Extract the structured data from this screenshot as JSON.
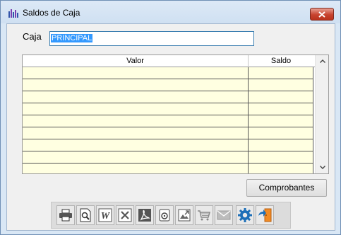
{
  "window": {
    "title": "Saldos de Caja"
  },
  "form": {
    "caja_label": "Caja",
    "caja_value": "PRINCIPAL"
  },
  "grid": {
    "columns": [
      "Valor",
      "Saldo"
    ],
    "rows": [
      [
        "",
        ""
      ],
      [
        "",
        ""
      ],
      [
        "",
        ""
      ],
      [
        "",
        ""
      ],
      [
        "",
        ""
      ],
      [
        "",
        ""
      ],
      [
        "",
        ""
      ],
      [
        "",
        ""
      ],
      [
        "",
        ""
      ]
    ]
  },
  "buttons": {
    "comprobantes": "Comprobantes"
  },
  "toolbar": {
    "icons": [
      "printer-icon",
      "preview-icon",
      "word-icon",
      "excel-icon",
      "pdf-icon",
      "disk-icon",
      "image-export-icon",
      "cart-icon",
      "mail-icon",
      "settings-icon",
      "exit-icon"
    ]
  },
  "colors": {
    "title_bg": "#dde9f6",
    "grid_row_bg": "#ffffe1",
    "selection": "#3399ff",
    "close_button": "#c8442f"
  }
}
